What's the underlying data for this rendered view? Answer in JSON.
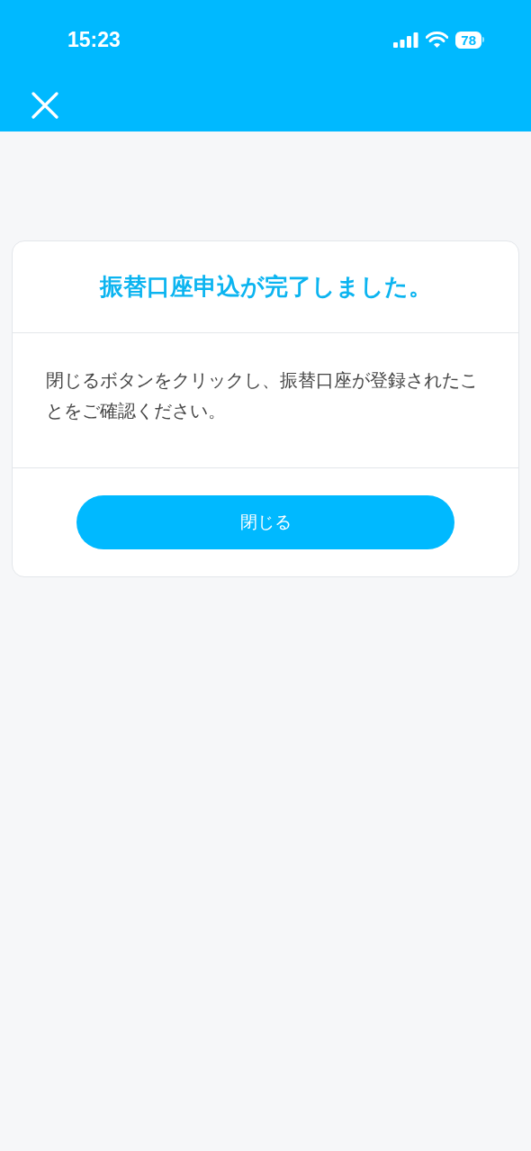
{
  "status_bar": {
    "time": "15:23",
    "battery": "78"
  },
  "card": {
    "title": "振替口座申込が完了しました。",
    "message": "閉じるボタンをクリックし、振替口座が登録されたことをご確認ください。",
    "button": "閉じる"
  }
}
